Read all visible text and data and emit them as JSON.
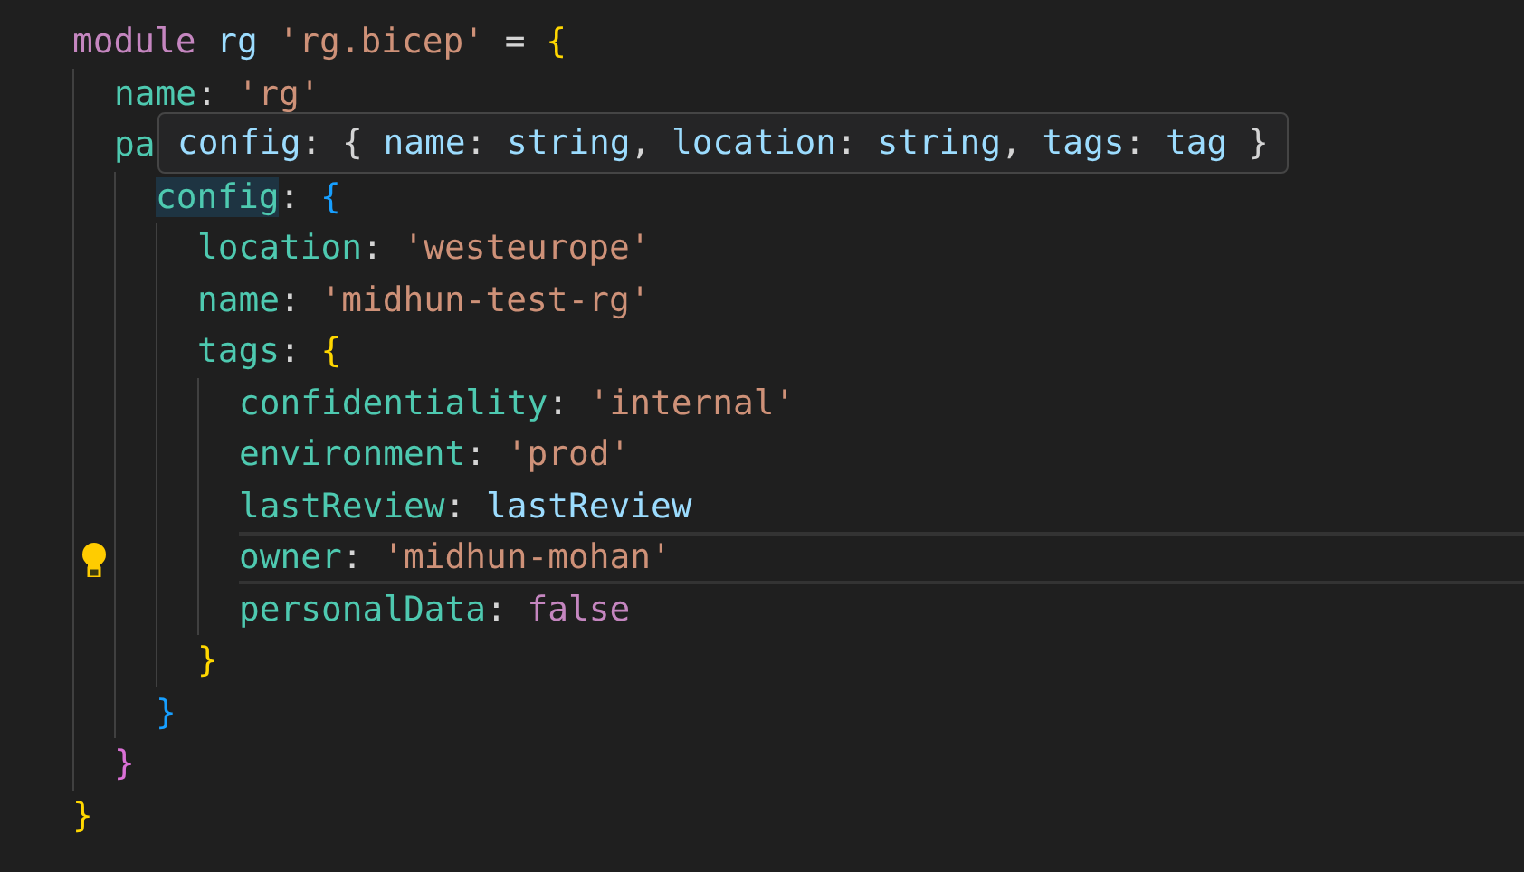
{
  "editor": {
    "lines": [
      {
        "tokens": [
          {
            "kind": "keyword",
            "text": "module "
          },
          {
            "kind": "variable",
            "text": "rg "
          },
          {
            "kind": "string",
            "text": "'rg.bicep'"
          },
          {
            "kind": "punct",
            "text": " = "
          },
          {
            "kind": "brace1",
            "text": "{"
          }
        ],
        "children": [
          {
            "tokens": [
              {
                "kind": "key",
                "text": "name"
              },
              {
                "kind": "punct",
                "text": ": "
              },
              {
                "kind": "string",
                "text": "'rg'"
              }
            ]
          },
          {
            "tokens": [
              {
                "kind": "key",
                "text": "pa"
              }
            ],
            "children": [
              {
                "tokens": [
                  {
                    "kind": "key",
                    "text": "config",
                    "highlighted": true
                  },
                  {
                    "kind": "punct",
                    "text": ": "
                  },
                  {
                    "kind": "brace3",
                    "text": "{"
                  }
                ],
                "children": [
                  {
                    "tokens": [
                      {
                        "kind": "key",
                        "text": "location"
                      },
                      {
                        "kind": "punct",
                        "text": ": "
                      },
                      {
                        "kind": "string",
                        "text": "'westeurope'"
                      }
                    ]
                  },
                  {
                    "tokens": [
                      {
                        "kind": "key",
                        "text": "name"
                      },
                      {
                        "kind": "punct",
                        "text": ": "
                      },
                      {
                        "kind": "string",
                        "text": "'midhun-test-rg'"
                      }
                    ]
                  },
                  {
                    "tokens": [
                      {
                        "kind": "key",
                        "text": "tags"
                      },
                      {
                        "kind": "punct",
                        "text": ": "
                      },
                      {
                        "kind": "brace1",
                        "text": "{"
                      }
                    ],
                    "children": [
                      {
                        "tokens": [
                          {
                            "kind": "key",
                            "text": "confidentiality"
                          },
                          {
                            "kind": "punct",
                            "text": ": "
                          },
                          {
                            "kind": "string",
                            "text": "'internal'"
                          }
                        ]
                      },
                      {
                        "tokens": [
                          {
                            "kind": "key",
                            "text": "environment"
                          },
                          {
                            "kind": "punct",
                            "text": ": "
                          },
                          {
                            "kind": "string",
                            "text": "'prod'"
                          }
                        ]
                      },
                      {
                        "tokens": [
                          {
                            "kind": "key",
                            "text": "lastReview"
                          },
                          {
                            "kind": "punct",
                            "text": ": "
                          },
                          {
                            "kind": "variable",
                            "text": "lastReview"
                          }
                        ]
                      },
                      {
                        "tokens": [
                          {
                            "kind": "key",
                            "text": "owner"
                          },
                          {
                            "kind": "punct",
                            "text": ": "
                          },
                          {
                            "kind": "string",
                            "text": "'midhun-mohan'"
                          }
                        ],
                        "current": true,
                        "lightbulb": true
                      },
                      {
                        "tokens": [
                          {
                            "kind": "key",
                            "text": "personalData"
                          },
                          {
                            "kind": "punct",
                            "text": ": "
                          },
                          {
                            "kind": "keyword",
                            "text": "false"
                          }
                        ]
                      }
                    ]
                  },
                  {
                    "tokens": [
                      {
                        "kind": "brace1",
                        "text": "}"
                      }
                    ]
                  }
                ]
              },
              {
                "tokens": [
                  {
                    "kind": "brace3",
                    "text": "}"
                  }
                ]
              }
            ]
          },
          {
            "tokens": [
              {
                "kind": "brace2",
                "text": "}"
              }
            ]
          }
        ]
      },
      {
        "tokens": [
          {
            "kind": "brace1",
            "text": "}"
          }
        ]
      }
    ]
  },
  "hover": {
    "tokens": [
      {
        "kind": "variable",
        "text": "config"
      },
      {
        "kind": "punct",
        "text": ": { "
      },
      {
        "kind": "variable",
        "text": "name"
      },
      {
        "kind": "punct",
        "text": ": "
      },
      {
        "kind": "variable",
        "text": "string"
      },
      {
        "kind": "punct",
        "text": ", "
      },
      {
        "kind": "variable",
        "text": "location"
      },
      {
        "kind": "punct",
        "text": ": "
      },
      {
        "kind": "variable",
        "text": "string"
      },
      {
        "kind": "punct",
        "text": ", "
      },
      {
        "kind": "variable",
        "text": "tags"
      },
      {
        "kind": "punct",
        "text": ": "
      },
      {
        "kind": "variable",
        "text": "tag"
      },
      {
        "kind": "punct",
        "text": " }"
      }
    ]
  }
}
